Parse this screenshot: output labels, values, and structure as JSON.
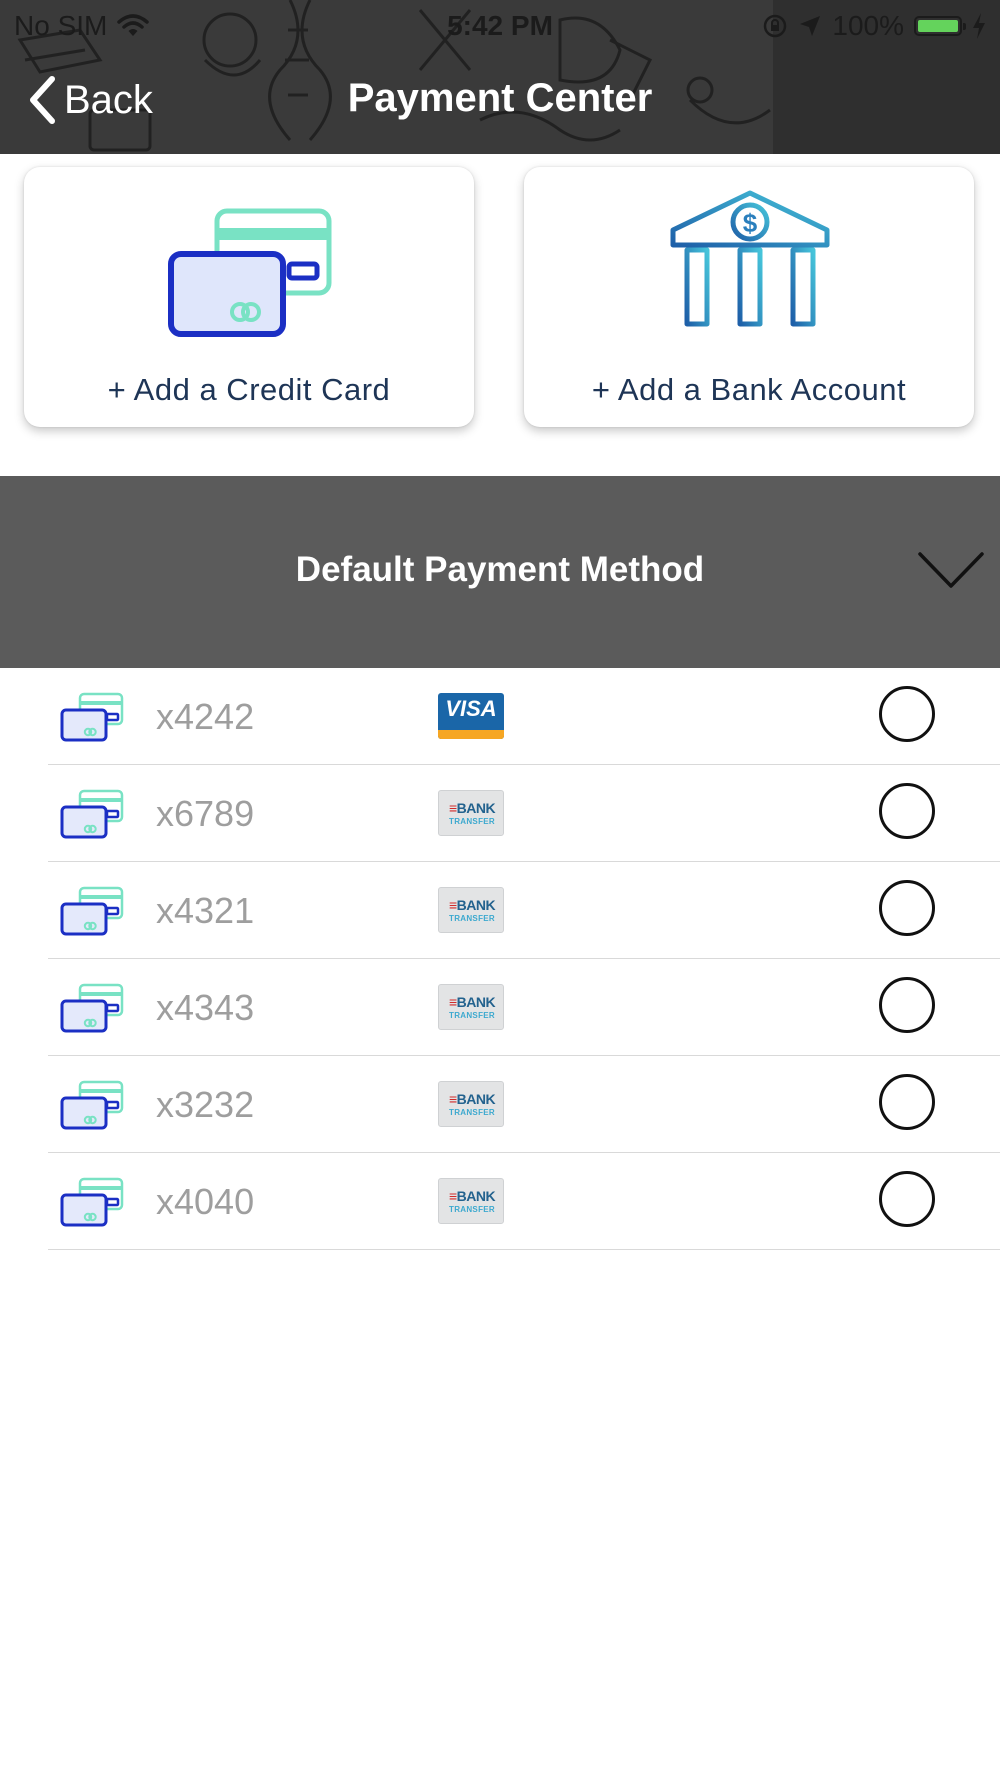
{
  "status_bar": {
    "carrier": "No SIM",
    "time": "5:42 PM",
    "battery": "100%"
  },
  "nav": {
    "back_label": "Back",
    "title": "Payment Center"
  },
  "actions": {
    "add_card_label": "+ Add a Credit Card",
    "add_bank_label": "+ Add a Bank Account"
  },
  "section": {
    "title": "Default Payment Method"
  },
  "methods": [
    {
      "label": "x4242",
      "brand": "visa",
      "brand_text": "VISA",
      "selected": false
    },
    {
      "label": "x6789",
      "brand": "bank",
      "brand_text": "BANK",
      "brand_subtext": "TRANSFER",
      "selected": false
    },
    {
      "label": "x4321",
      "brand": "bank",
      "brand_text": "BANK",
      "brand_subtext": "TRANSFER",
      "selected": false
    },
    {
      "label": "x4343",
      "brand": "bank",
      "brand_text": "BANK",
      "brand_subtext": "TRANSFER",
      "selected": false
    },
    {
      "label": "x3232",
      "brand": "bank",
      "brand_text": "BANK",
      "brand_subtext": "TRANSFER",
      "selected": false
    },
    {
      "label": "x4040",
      "brand": "bank",
      "brand_text": "BANK",
      "brand_subtext": "TRANSFER",
      "selected": false
    }
  ],
  "colors": {
    "header_bg": "#3a3a3a",
    "section_bg": "#5b5b5b",
    "card_icon_blue": "#1b2fc4",
    "card_icon_mint": "#79e2c4",
    "bank_icon_gradient": [
      "#1e5fa8",
      "#46c4da"
    ],
    "battery_green": "#64d35c",
    "visa_blue": "#1a66a8",
    "visa_gold": "#f6a623"
  }
}
